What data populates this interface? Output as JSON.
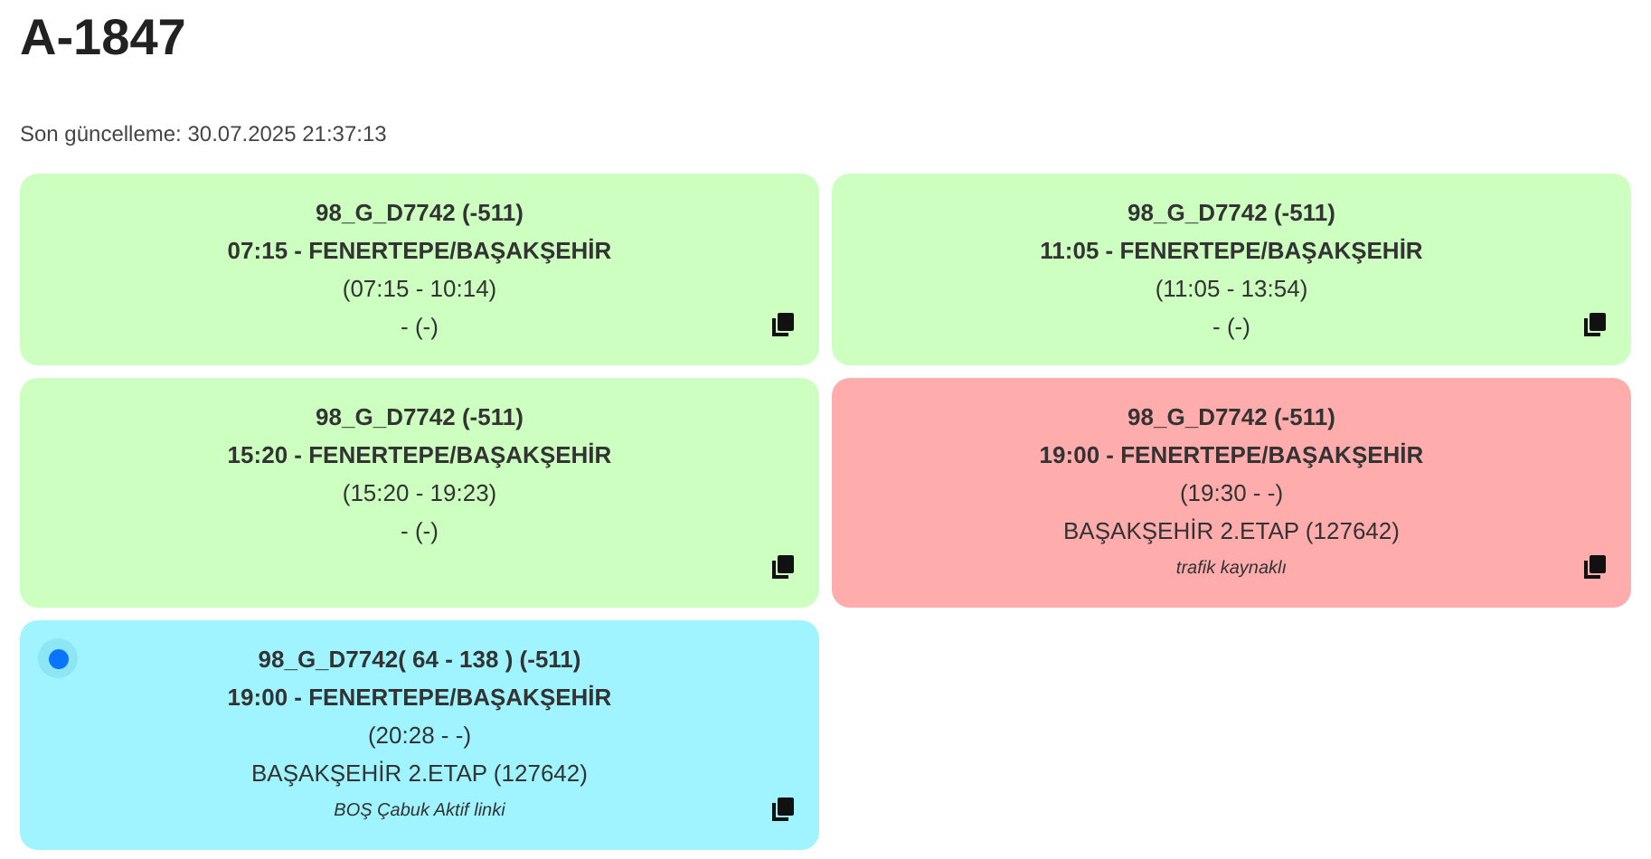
{
  "title": "A-1847",
  "last_updated": "Son güncelleme: 30.07.2025 21:37:13",
  "cards": [
    {
      "color": "#ccffc0",
      "live": false,
      "line": "98_G_D7742 (-511)",
      "trip": "07:15 - FENERTEPE/BAŞAKŞEHİR",
      "times": "(07:15 - 10:14)",
      "stop": "- (-)"
    },
    {
      "color": "#ccffc0",
      "live": false,
      "line": "98_G_D7742 (-511)",
      "trip": "11:05 - FENERTEPE/BAŞAKŞEHİR",
      "times": "(11:05 - 13:54)",
      "stop": "- (-)"
    },
    {
      "color": "#ccffc0",
      "live": false,
      "line": "98_G_D7742 (-511)",
      "trip": "15:20 - FENERTEPE/BAŞAKŞEHİR",
      "times": "(15:20 - 19:23)",
      "stop": "- (-)"
    },
    {
      "color": "#ffacac",
      "live": false,
      "line": "98_G_D7742 (-511)",
      "trip": "19:00 - FENERTEPE/BAŞAKŞEHİR",
      "times": "(19:30 - -)",
      "stop": "BAŞAKŞEHİR 2.ETAP (127642)",
      "note": "trafik kaynaklı"
    },
    {
      "color": "#9ff4ff",
      "live": true,
      "line": "98_G_D7742( 64 - 138 ) (-511)",
      "trip": "19:00 - FENERTEPE/BAŞAKŞEHİR",
      "times": "(20:28 - -)",
      "stop": "BAŞAKŞEHİR 2.ETAP (127642)",
      "note": "BOŞ Çabuk Aktif linki"
    }
  ]
}
